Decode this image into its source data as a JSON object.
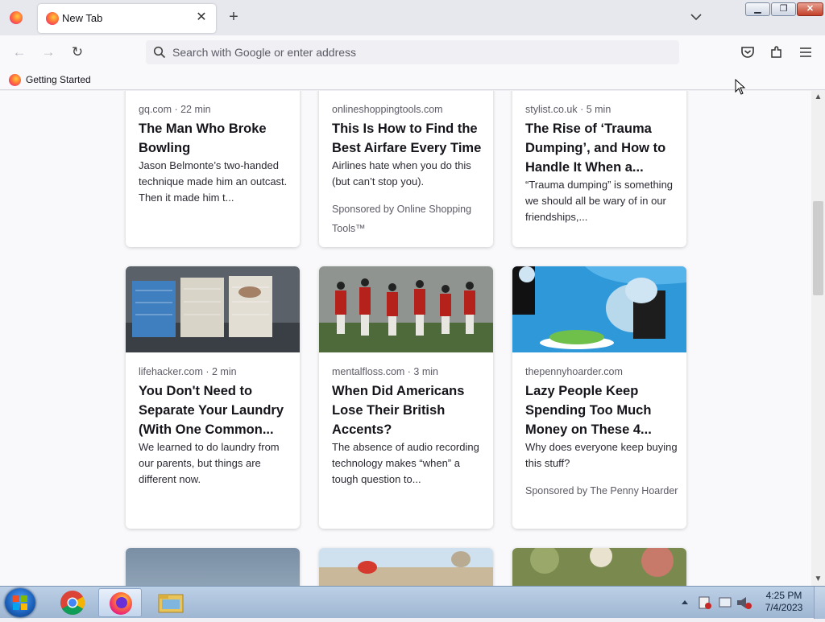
{
  "browser": {
    "tab": {
      "label": "New Tab",
      "close": "✕"
    },
    "new_tab": "+",
    "window_controls": {
      "min": "▁",
      "max": "❐",
      "close": "✕"
    },
    "nav": {
      "back": "←",
      "forward": "→",
      "reload": "↻"
    },
    "address_placeholder": "Search with Google or enter address",
    "bookmarks": [
      {
        "label": "Getting Started"
      }
    ]
  },
  "cards": [
    {
      "source": "gq.com · 22 min",
      "title": "The Man Who Broke Bowling",
      "desc": "Jason Belmonte’s two-handed technique made him an outcast. Then it made him t...",
      "sponsor": ""
    },
    {
      "source": "onlineshoppingtools.com",
      "title": "This Is How to Find the Best Airfare Every Time",
      "desc": "Airlines hate when you do this (but can’t stop you).",
      "sponsor": "Sponsored by Online Shopping Tools™"
    },
    {
      "source": "stylist.co.uk · 5 min",
      "title": "The Rise of ‘Trauma Dumping’, and How to Handle It When a...",
      "desc": "“Trauma dumping” is something we should all be wary of in our friendships,...",
      "sponsor": ""
    },
    {
      "source": "lifehacker.com · 2 min",
      "title": "You Don't Need to Separate Your Laundry (With One Common...",
      "desc": "We learned to do laundry from our parents, but things are different now.",
      "sponsor": ""
    },
    {
      "source": "mentalfloss.com · 3 min",
      "title": "When Did Americans Lose Their British Accents?",
      "desc": "The absence of audio recording technology makes “when” a tough question to...",
      "sponsor": ""
    },
    {
      "source": "thepennyhoarder.com",
      "title": "Lazy People Keep Spending Too Much Money on These 4...",
      "desc": "Why does everyone keep buying this stuff?",
      "sponsor": "Sponsored by The Penny Hoarder"
    }
  ],
  "taskbar": {
    "time": "4:25 PM",
    "date": "7/4/2023"
  },
  "colors": {
    "accent": "#0060df",
    "page_bg": "#f9f9fb",
    "tabstrip_bg": "#e6e8ee"
  }
}
